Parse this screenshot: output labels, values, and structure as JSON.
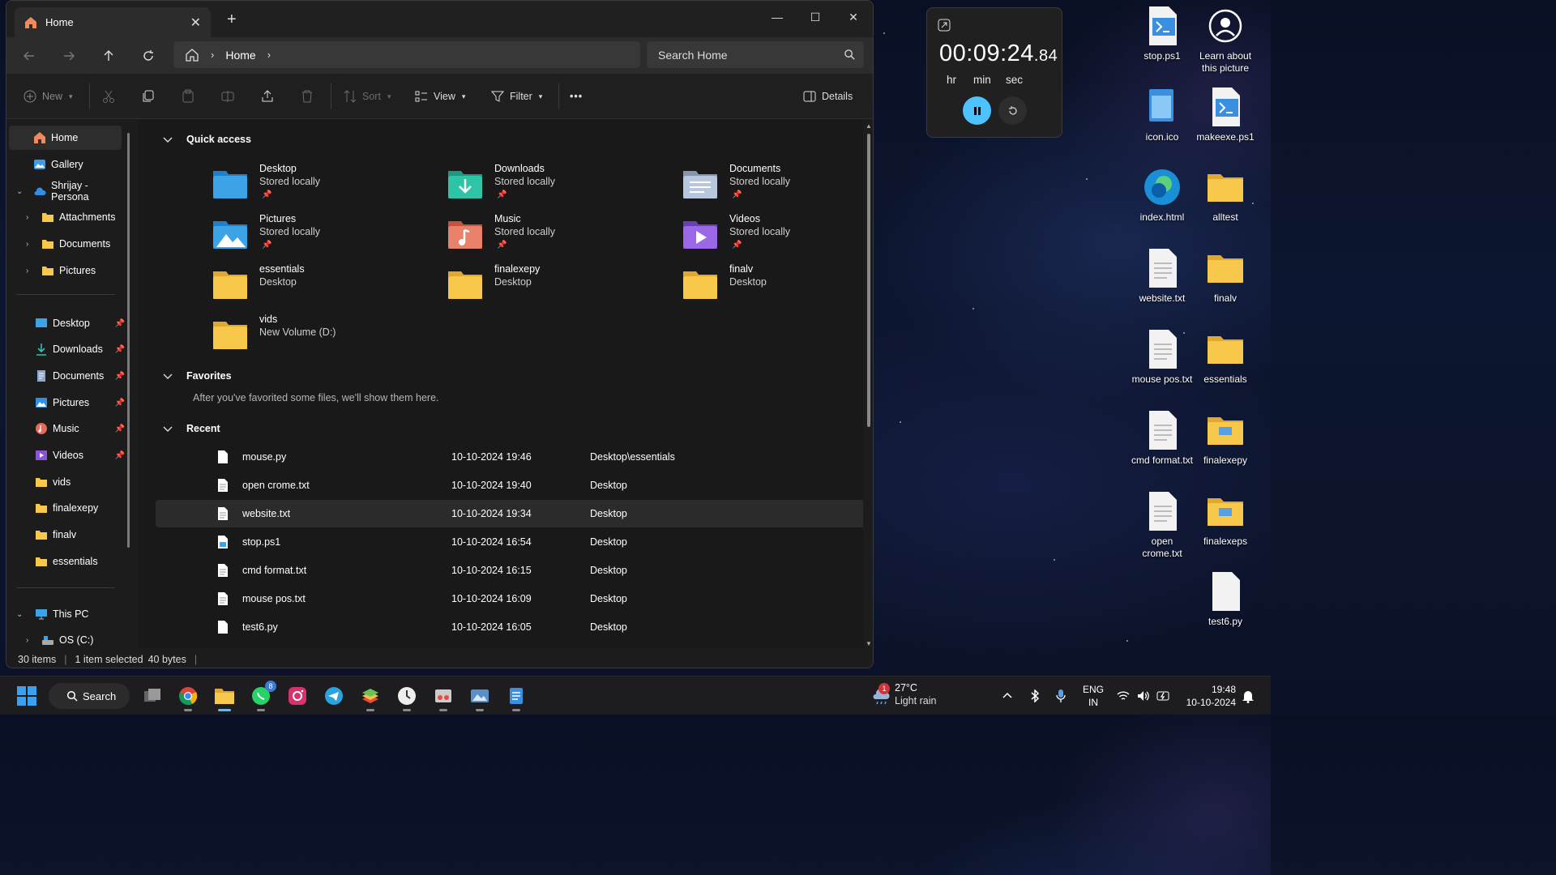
{
  "window": {
    "tab_title": "Home",
    "close_tab": "✕",
    "new_tab": "+",
    "minimize": "—",
    "maximize": "☐",
    "close": "✕"
  },
  "nav": {
    "breadcrumb": "Home",
    "search_placeholder": "Search Home"
  },
  "commands": {
    "new": "New",
    "sort": "Sort",
    "view": "View",
    "filter": "Filter",
    "more": "•••",
    "details": "Details"
  },
  "sidebar": {
    "home": "Home",
    "gallery": "Gallery",
    "onedrive": "Shrijay - Persona",
    "od_attachments": "Attachments",
    "od_documents": "Documents",
    "od_pictures": "Pictures",
    "desktop": "Desktop",
    "downloads": "Downloads",
    "documents": "Documents",
    "pictures": "Pictures",
    "music": "Music",
    "videos": "Videos",
    "vids": "vids",
    "finalexepy": "finalexepy",
    "finalv": "finalv",
    "essentials": "essentials",
    "this_pc": "This PC",
    "os_c": "OS (C:)"
  },
  "quick_access": {
    "title": "Quick access",
    "items": [
      {
        "name": "Desktop",
        "sub": "Stored locally",
        "pin": "📌"
      },
      {
        "name": "Downloads",
        "sub": "Stored locally",
        "pin": "📌"
      },
      {
        "name": "Documents",
        "sub": "Stored locally",
        "pin": "📌"
      },
      {
        "name": "Pictures",
        "sub": "Stored locally",
        "pin": "📌"
      },
      {
        "name": "Music",
        "sub": "Stored locally",
        "pin": "📌"
      },
      {
        "name": "Videos",
        "sub": "Stored locally",
        "pin": "📌"
      },
      {
        "name": "essentials",
        "sub": "Desktop"
      },
      {
        "name": "finalexepy",
        "sub": "Desktop"
      },
      {
        "name": "finalv",
        "sub": "Desktop"
      },
      {
        "name": "vids",
        "sub": "New Volume (D:)"
      }
    ]
  },
  "favorites": {
    "title": "Favorites",
    "empty_text": "After you've favorited some files, we'll show them here."
  },
  "recent": {
    "title": "Recent",
    "rows": [
      {
        "name": "mouse.py",
        "date": "10-10-2024 19:46",
        "location": "Desktop\\essentials"
      },
      {
        "name": "open crome.txt",
        "date": "10-10-2024 19:40",
        "location": "Desktop"
      },
      {
        "name": "website.txt",
        "date": "10-10-2024 19:34",
        "location": "Desktop"
      },
      {
        "name": "stop.ps1",
        "date": "10-10-2024 16:54",
        "location": "Desktop"
      },
      {
        "name": "cmd format.txt",
        "date": "10-10-2024 16:15",
        "location": "Desktop"
      },
      {
        "name": "mouse pos.txt",
        "date": "10-10-2024 16:09",
        "location": "Desktop"
      },
      {
        "name": "test6.py",
        "date": "10-10-2024 16:05",
        "location": "Desktop"
      }
    ]
  },
  "status": {
    "items": "30 items",
    "selected": "1 item selected",
    "size": "40 bytes",
    "separator": "|"
  },
  "timer": {
    "main": "00:09:24",
    "fraction": ".84",
    "hr": "hr",
    "min": "min",
    "sec": "sec"
  },
  "desktop_icons": [
    {
      "label": "stop.ps1"
    },
    {
      "label": "Learn about this picture"
    },
    {
      "label": "icon.ico"
    },
    {
      "label": "makeexe.ps1"
    },
    {
      "label": "index.html"
    },
    {
      "label": "alltest"
    },
    {
      "label": "website.txt"
    },
    {
      "label": "finalv"
    },
    {
      "label": "mouse pos.txt"
    },
    {
      "label": "essentials"
    },
    {
      "label": "cmd format.txt"
    },
    {
      "label": "finalexepy"
    },
    {
      "label": "open crome.txt"
    },
    {
      "label": "finalexeps"
    },
    {
      "label": "test6.py"
    }
  ],
  "taskbar": {
    "search": "Search",
    "whatsapp_badge": "8",
    "weather_temp": "27°C",
    "weather_desc": "Light rain",
    "weather_badge": "1",
    "lang1": "ENG",
    "lang2": "IN",
    "time": "19:48",
    "date": "10-10-2024"
  },
  "colors": {
    "accent": "#4cc2ff",
    "folder_yellow": "#f8c84a"
  }
}
